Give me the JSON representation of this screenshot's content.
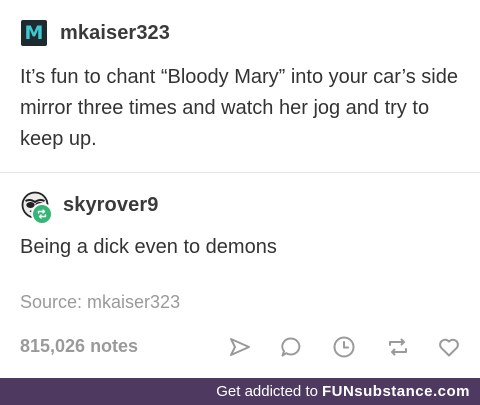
{
  "post": {
    "original": {
      "username": "mkaiser323",
      "avatar_letter": "M",
      "text": "It’s fun to chant “Bloody Mary” into your car’s side mirror three times and watch her jog and try to keep up."
    },
    "reblog": {
      "username": "skyrover9",
      "text": "Being a dick even to demons"
    },
    "source": "Source: mkaiser323",
    "notes": "815,026 notes",
    "actions": [
      "share-icon",
      "reply-icon",
      "queue-icon",
      "reblog-icon",
      "like-icon"
    ]
  },
  "footer": {
    "text": "Get addicted to",
    "brand": "FUNsubstance.com"
  },
  "colors": {
    "text": "#333333",
    "muted": "#9a9a9a",
    "footer_bg": "#4e3a60",
    "reblog_badge": "#35b675",
    "avatar_bg": "#1f2a30",
    "avatar_letter": "#3fc7d0"
  }
}
